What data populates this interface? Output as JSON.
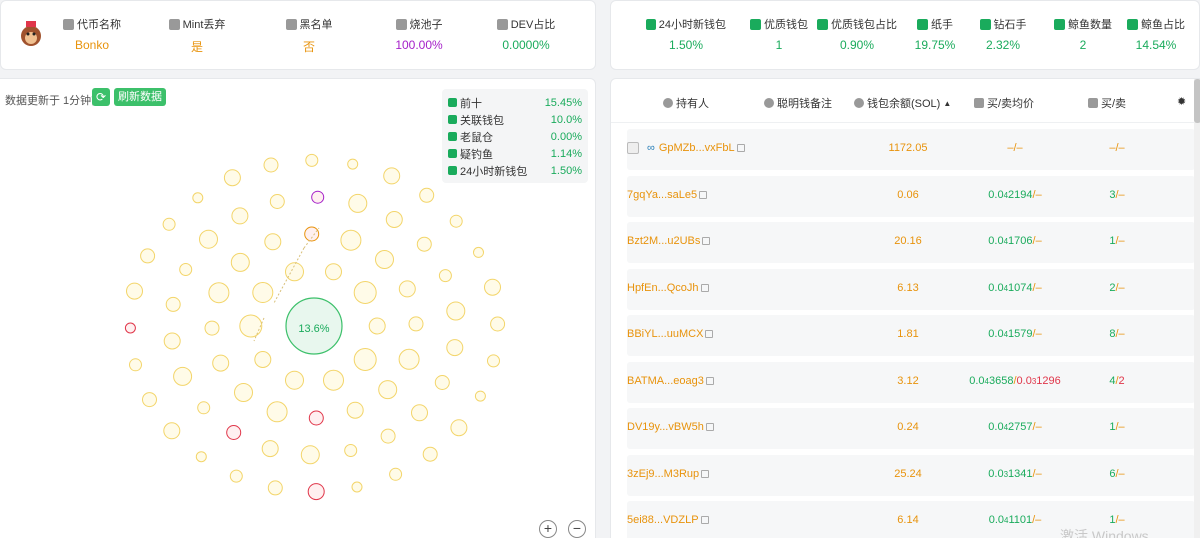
{
  "token_stats": {
    "avatar": "monkey-avatar",
    "items": [
      {
        "label": "代币名称",
        "value": "Bonko",
        "icon": "coin-stack-icon",
        "color": "#e8930c"
      },
      {
        "label": "Mint丢弃",
        "value": "是",
        "icon": "user-icon",
        "color": "#e8930c"
      },
      {
        "label": "黑名单",
        "value": "否",
        "icon": "user-icon",
        "color": "#e8930c"
      },
      {
        "label": "烧池子",
        "value": "100.00%",
        "icon": "fire-box-icon",
        "color": "#a51fc9"
      },
      {
        "label": "DEV占比",
        "value": "0.0000%",
        "icon": "dev-icon",
        "color": "#1aab5c"
      }
    ]
  },
  "wallet_stats": {
    "items": [
      {
        "label": "24小时新钱包",
        "value": "1.50%",
        "icon": "new-wallet-icon"
      },
      {
        "label": "优质钱包",
        "value": "1",
        "icon": "bag-icon"
      },
      {
        "label": "优质钱包占比",
        "value": "0.90%",
        "icon": "bag-icon"
      },
      {
        "label": "纸手",
        "value": "19.75%",
        "icon": "paper-icon"
      },
      {
        "label": "钻石手",
        "value": "2.32%",
        "icon": "diamond-icon"
      },
      {
        "label": "鲸鱼数量",
        "value": "2",
        "icon": "whale-icon"
      },
      {
        "label": "鲸鱼占比",
        "value": "14.54%",
        "icon": "whale-icon"
      }
    ]
  },
  "bubble_map": {
    "update_text": "数据更新于 1分钟前",
    "refresh_label": "刷新数据",
    "center_label": "13.6%",
    "legend": [
      {
        "label": "前十",
        "value": "15.45%",
        "icon": "top-ten-icon"
      },
      {
        "label": "关联钱包",
        "value": "10.0%",
        "icon": "link-icon"
      },
      {
        "label": "老鼠仓",
        "value": "0.00%",
        "icon": "rat-icon"
      },
      {
        "label": "疑钓鱼",
        "value": "1.14%",
        "icon": "fishing-icon"
      },
      {
        "label": "24小时新钱包",
        "value": "1.50%",
        "icon": "new-wallet-icon"
      }
    ],
    "zoom_in": "+",
    "zoom_out": "−"
  },
  "holders": {
    "columns": [
      "持有人",
      "聪明钱备注",
      "钱包余额(SOL)",
      "买/卖均价",
      "买/卖"
    ],
    "sort_indicator": "▲",
    "rows": [
      {
        "address": "GpMZb...vxFbL",
        "balance": "1172.05",
        "avg_buy": "–",
        "avg_sell": "–",
        "avg_buy_sub": "",
        "avg_buy_tail": "",
        "avg_sell_sub": "",
        "avg_sell_tail": "",
        "buys": "–",
        "sells": "–"
      },
      {
        "address": "7gqYa...saLe5",
        "balance": "0.06",
        "avg_buy": "0.0",
        "avg_buy_sub": "4",
        "avg_buy_tail": "2194",
        "avg_sell": "–",
        "avg_sell_sub": "",
        "avg_sell_tail": "",
        "buys": "3",
        "sells": "–"
      },
      {
        "address": "Bzt2M...u2UBs",
        "balance": "20.16",
        "avg_buy": "0.0",
        "avg_buy_sub": "4",
        "avg_buy_tail": "1706",
        "avg_sell": "–",
        "avg_sell_sub": "",
        "avg_sell_tail": "",
        "buys": "1",
        "sells": "–"
      },
      {
        "address": "HpfEn...QcoJh",
        "balance": "6.13",
        "avg_buy": "0.0",
        "avg_buy_sub": "4",
        "avg_buy_tail": "1074",
        "avg_sell": "–",
        "avg_sell_sub": "",
        "avg_sell_tail": "",
        "buys": "2",
        "sells": "–"
      },
      {
        "address": "BBiYL...uuMCX",
        "balance": "1.81",
        "avg_buy": "0.0",
        "avg_buy_sub": "4",
        "avg_buy_tail": "1579",
        "avg_sell": "–",
        "avg_sell_sub": "",
        "avg_sell_tail": "",
        "buys": "8",
        "sells": "–"
      },
      {
        "address": "BATMA...eoag3",
        "balance": "3.12",
        "avg_buy": "0.0",
        "avg_buy_sub": "4",
        "avg_buy_tail": "3658",
        "avg_sell": "0.0",
        "avg_sell_sub": "3",
        "avg_sell_tail": "1296",
        "buys": "4",
        "sells": "2"
      },
      {
        "address": "DV19y...vBW5h",
        "balance": "0.24",
        "avg_buy": "0.0",
        "avg_buy_sub": "4",
        "avg_buy_tail": "2757",
        "avg_sell": "–",
        "avg_sell_sub": "",
        "avg_sell_tail": "",
        "buys": "1",
        "sells": "–"
      },
      {
        "address": "3zEj9...M3Rup",
        "balance": "25.24",
        "avg_buy": "0.0",
        "avg_buy_sub": "3",
        "avg_buy_tail": "1341",
        "avg_sell": "–",
        "avg_sell_sub": "",
        "avg_sell_tail": "",
        "buys": "6",
        "sells": "–"
      },
      {
        "address": "5ei88...VDZLP",
        "balance": "6.14",
        "avg_buy": "0.0",
        "avg_buy_sub": "4",
        "avg_buy_tail": "1101",
        "avg_sell": "–",
        "avg_sell_sub": "",
        "avg_sell_tail": "",
        "buys": "1",
        "sells": "–"
      }
    ]
  },
  "watermark": "激活 Windows",
  "colors": {
    "accent_green": "#1aab5c",
    "accent_orange": "#e8930c",
    "accent_purple": "#a51fc9",
    "accent_red": "#e0364a"
  }
}
